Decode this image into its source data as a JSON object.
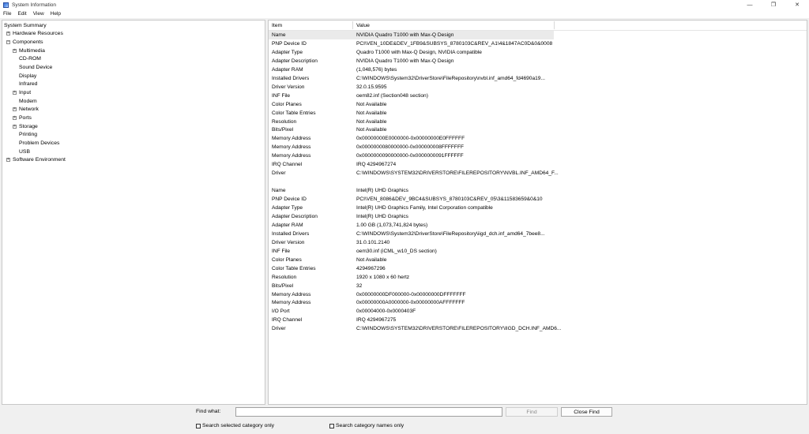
{
  "window": {
    "title": "System Information",
    "controls": {
      "minimize": "—",
      "maximize": "❐",
      "close": "✕"
    }
  },
  "menu": [
    "File",
    "Edit",
    "View",
    "Help"
  ],
  "tree": [
    {
      "label": "System Summary",
      "level": 0,
      "expander": ""
    },
    {
      "label": "Hardware Resources",
      "level": 1,
      "expander": "+"
    },
    {
      "label": "Components",
      "level": 1,
      "expander": "−"
    },
    {
      "label": "Multimedia",
      "level": 2,
      "expander": "+"
    },
    {
      "label": "CD-ROM",
      "level": 2,
      "expander": ""
    },
    {
      "label": "Sound Device",
      "level": 2,
      "expander": ""
    },
    {
      "label": "Display",
      "level": 2,
      "expander": ""
    },
    {
      "label": "Infrared",
      "level": 2,
      "expander": ""
    },
    {
      "label": "Input",
      "level": 2,
      "expander": "+"
    },
    {
      "label": "Modem",
      "level": 2,
      "expander": ""
    },
    {
      "label": "Network",
      "level": 2,
      "expander": "+"
    },
    {
      "label": "Ports",
      "level": 2,
      "expander": "+"
    },
    {
      "label": "Storage",
      "level": 2,
      "expander": "+"
    },
    {
      "label": "Printing",
      "level": 2,
      "expander": ""
    },
    {
      "label": "Problem Devices",
      "level": 2,
      "expander": ""
    },
    {
      "label": "USB",
      "level": 2,
      "expander": ""
    },
    {
      "label": "Software Environment",
      "level": 1,
      "expander": "+"
    }
  ],
  "list": {
    "headers": {
      "item": "Item",
      "value": "Value"
    },
    "rows": [
      {
        "item": "Name",
        "value": "NVIDIA Quadro T1000 with Max-Q Design",
        "selected": true
      },
      {
        "item": "PNP Device ID",
        "value": "PCI\\VEN_10DE&DEV_1FB9&SUBSYS_8780103C&REV_A1\\4&1847AC0D&0&0008"
      },
      {
        "item": "Adapter Type",
        "value": "Quadro T1000 with Max-Q Design, NVIDIA compatible"
      },
      {
        "item": "Adapter Description",
        "value": "NVIDIA Quadro T1000 with Max-Q Design"
      },
      {
        "item": "Adapter RAM",
        "value": "(1,048,576) bytes"
      },
      {
        "item": "Installed Drivers",
        "value": "C:\\WINDOWS\\System32\\DriverStore\\FileRepository\\nvbl.inf_amd64_fd4690a19..."
      },
      {
        "item": "Driver Version",
        "value": "32.0.15.9595"
      },
      {
        "item": "INF File",
        "value": "oem82.inf (Section048 section)"
      },
      {
        "item": "Color Planes",
        "value": "Not Available"
      },
      {
        "item": "Color Table Entries",
        "value": "Not Available"
      },
      {
        "item": "Resolution",
        "value": "Not Available"
      },
      {
        "item": "Bits/Pixel",
        "value": "Not Available"
      },
      {
        "item": "Memory Address",
        "value": "0x00000000E0000000-0x00000000E0FFFFFF"
      },
      {
        "item": "Memory Address",
        "value": "0x0000000080000000-0x000000008FFFFFFF"
      },
      {
        "item": "Memory Address",
        "value": "0x0000000090000000-0x0000000091FFFFFF"
      },
      {
        "item": "IRQ Channel",
        "value": "IRQ 4294967274"
      },
      {
        "item": "Driver",
        "value": "C:\\WINDOWS\\SYSTEM32\\DRIVERSTORE\\FILEREPOSITORY\\NVBL.INF_AMD64_F..."
      },
      {
        "item": "",
        "value": ""
      },
      {
        "item": "Name",
        "value": "Intel(R) UHD Graphics"
      },
      {
        "item": "PNP Device ID",
        "value": "PCI\\VEN_8086&DEV_9BC4&SUBSYS_8780103C&REV_05\\3&11583659&0&10"
      },
      {
        "item": "Adapter Type",
        "value": "Intel(R) UHD Graphics Family, Intel Corporation compatible"
      },
      {
        "item": "Adapter Description",
        "value": "Intel(R) UHD Graphics"
      },
      {
        "item": "Adapter RAM",
        "value": "1.00 GB (1,073,741,824 bytes)"
      },
      {
        "item": "Installed Drivers",
        "value": "C:\\WINDOWS\\System32\\DriverStore\\FileRepository\\iigd_dch.inf_amd64_7bee8..."
      },
      {
        "item": "Driver Version",
        "value": "31.0.101.2140"
      },
      {
        "item": "INF File",
        "value": "oem30.inf (iCML_w10_DS section)"
      },
      {
        "item": "Color Planes",
        "value": "Not Available"
      },
      {
        "item": "Color Table Entries",
        "value": "4294967296"
      },
      {
        "item": "Resolution",
        "value": "1920 x 1080 x 60 hertz"
      },
      {
        "item": "Bits/Pixel",
        "value": "32"
      },
      {
        "item": "Memory Address",
        "value": "0x00000000DF000000-0x00000000DFFFFFFF"
      },
      {
        "item": "Memory Address",
        "value": "0x00000000A0000000-0x00000000AFFFFFFF"
      },
      {
        "item": "I/O Port",
        "value": "0x00004000-0x0000403F"
      },
      {
        "item": "IRQ Channel",
        "value": "IRQ 4294967275"
      },
      {
        "item": "Driver",
        "value": "C:\\WINDOWS\\SYSTEM32\\DRIVERSTORE\\FILEREPOSITORY\\IIGD_DCH.INF_AMD6..."
      }
    ]
  },
  "find": {
    "label": "Find what:",
    "input_value": "",
    "find_button": "Find",
    "close_button": "Close Find",
    "search_selected": {
      "label": "Search selected category only",
      "checked": false
    },
    "search_names": {
      "label": "Search category names only",
      "checked": false
    }
  }
}
